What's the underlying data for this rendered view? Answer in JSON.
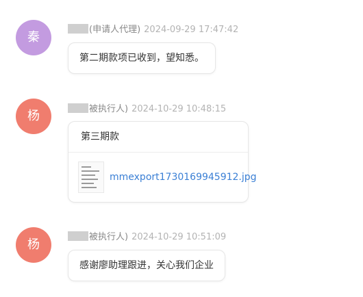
{
  "messages": [
    {
      "avatar_char": "秦",
      "avatar_color": "#c39be0",
      "role": "(申请人代理)",
      "time": "2024-09-29 17:47:42",
      "text": "第二期款项已收到，望知悉。"
    },
    {
      "avatar_char": "杨",
      "avatar_color": "#f07d6e",
      "role": "被执行人)",
      "time": "2024-10-29 10:48:15",
      "card_title": "第三期款",
      "attachment_name": "mmexport1730169945912.jpg"
    },
    {
      "avatar_char": "杨",
      "avatar_color": "#f07d6e",
      "role": "被执行人)",
      "time": "2024-10-29 10:51:09",
      "text": "感谢廖助理跟进，关心我们企业"
    }
  ]
}
